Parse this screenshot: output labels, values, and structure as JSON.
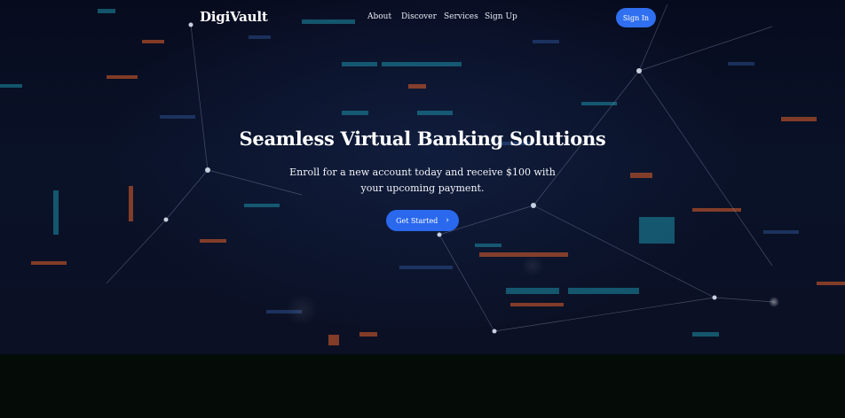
{
  "brand": {
    "name": "DigiVault"
  },
  "nav": {
    "links": [
      {
        "label": "About"
      },
      {
        "label": "Discover"
      },
      {
        "label": "Services"
      },
      {
        "label": "Sign Up"
      }
    ],
    "signin_label": "Sign In"
  },
  "hero": {
    "title": "Seamless Virtual Banking Solutions",
    "subtitle": "Enroll for a new account today and receive $100 with your upcoming payment.",
    "cta_label": "Get Started",
    "cta_icon": "chevron-right-icon"
  },
  "colors": {
    "accent": "#2f6ff0",
    "background": "#0a1228",
    "footer_band": "#050c08"
  }
}
